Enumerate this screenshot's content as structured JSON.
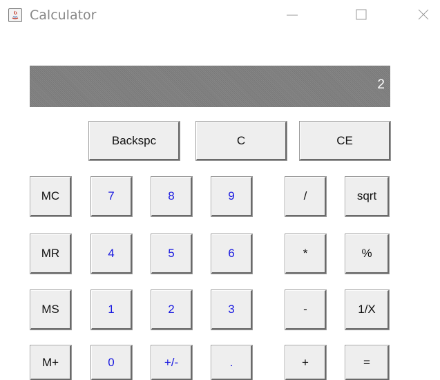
{
  "window": {
    "title": "Calculator",
    "icon": "java-app-icon",
    "controls": [
      "minimize-icon",
      "maximize-icon",
      "close-icon"
    ]
  },
  "display": {
    "value": "2"
  },
  "buttons": {
    "backspace": "Backspc",
    "clear": "C",
    "clear_entry": "CE",
    "mc": "MC",
    "mr": "MR",
    "ms": "MS",
    "mplus": "M+",
    "d7": "7",
    "d8": "8",
    "d9": "9",
    "d4": "4",
    "d5": "5",
    "d6": "6",
    "d1": "1",
    "d2": "2",
    "d3": "3",
    "d0": "0",
    "sign": "+/-",
    "dot": ".",
    "divide": "/",
    "multiply": "*",
    "subtract": "-",
    "add": "+",
    "sqrt": "sqrt",
    "percent": "%",
    "reciprocal": "1/X",
    "equals": "="
  },
  "colors": {
    "digit_text": "#1818e0",
    "display_bg": "#808080",
    "button_bg": "#eeeeee"
  }
}
